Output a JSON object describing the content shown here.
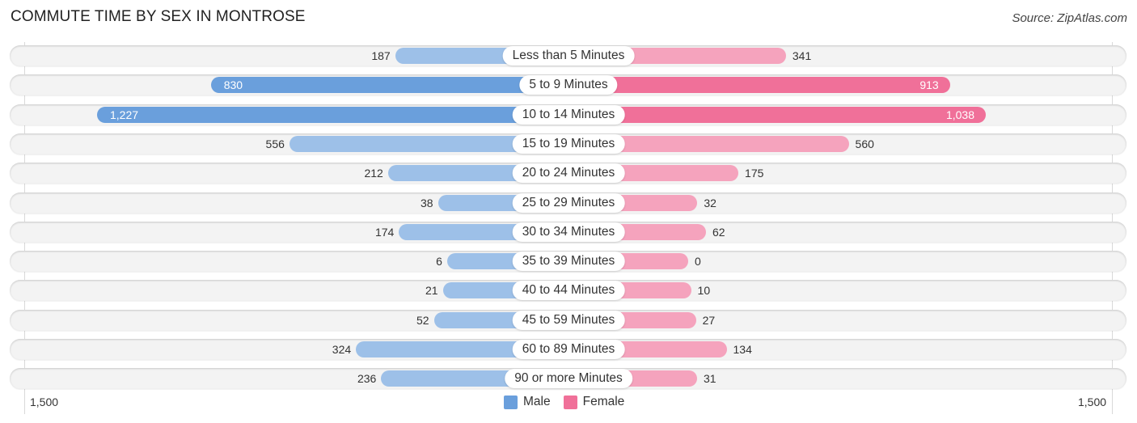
{
  "title": "COMMUTE TIME BY SEX IN MONTROSE",
  "source": "Source: ZipAtlas.com",
  "colors": {
    "male": "#6a9fdc",
    "male_light": "#9dc0e8",
    "female": "#f07099",
    "female_light": "#f5a3bd"
  },
  "chart_data": {
    "type": "bar",
    "orientation": "horizontal-diverging",
    "title": "COMMUTE TIME BY SEX IN MONTROSE",
    "categories": [
      "Less than 5 Minutes",
      "5 to 9 Minutes",
      "10 to 14 Minutes",
      "15 to 19 Minutes",
      "20 to 24 Minutes",
      "25 to 29 Minutes",
      "30 to 34 Minutes",
      "35 to 39 Minutes",
      "40 to 44 Minutes",
      "45 to 59 Minutes",
      "60 to 89 Minutes",
      "90 or more Minutes"
    ],
    "series": [
      {
        "name": "Male",
        "values": [
          187,
          830,
          1227,
          556,
          212,
          38,
          174,
          6,
          21,
          52,
          324,
          236
        ],
        "labels": [
          "187",
          "830",
          "1,227",
          "556",
          "212",
          "38",
          "174",
          "6",
          "21",
          "52",
          "324",
          "236"
        ]
      },
      {
        "name": "Female",
        "values": [
          341,
          913,
          1038,
          560,
          175,
          32,
          62,
          0,
          10,
          27,
          134,
          31
        ],
        "labels": [
          "341",
          "913",
          "1,038",
          "560",
          "175",
          "32",
          "62",
          "0",
          "10",
          "27",
          "134",
          "31"
        ]
      }
    ],
    "axis": {
      "left_label": "1,500",
      "right_label": "1,500",
      "range": [
        -1500,
        1500
      ]
    },
    "legend": {
      "position": "bottom-center",
      "entries": [
        "Male",
        "Female"
      ]
    },
    "xlabel": "",
    "ylabel": ""
  }
}
